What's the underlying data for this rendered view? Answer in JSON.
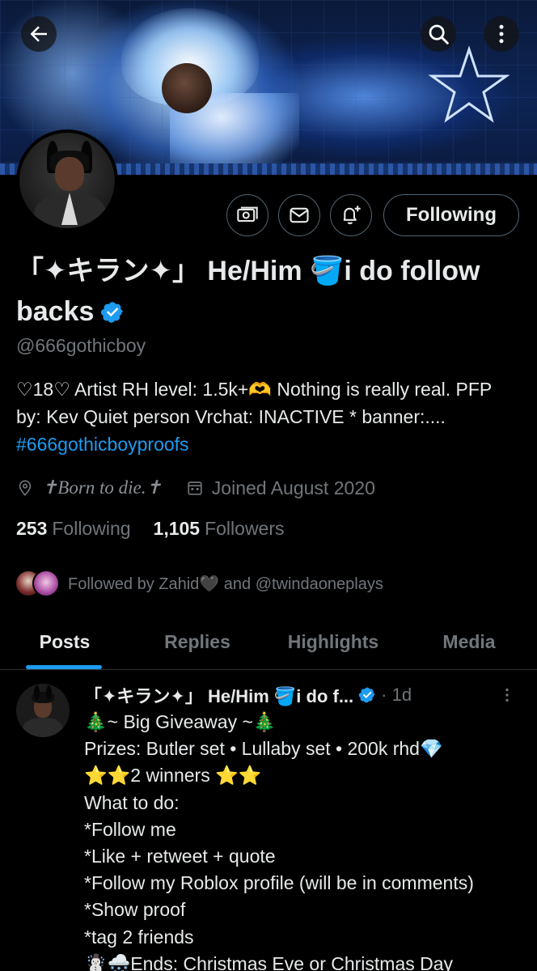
{
  "header": {
    "back_icon": "arrow-left-icon",
    "search_icon": "search-icon",
    "more_icon": "more-vertical-icon"
  },
  "profile": {
    "name": "「✦キラン✦」 He/Him 🪣i do follow backs",
    "verified": true,
    "handle": "@666gothicboy",
    "bio_text": "♡18♡ Artist RH level: 1.5k+🫶 Nothing is really real. PFP by: Kev Quiet person Vrchat: INACTIVE * banner:.... ",
    "bio_hashtag": "#666gothicboyproofs",
    "location": "✝Born to die.✝",
    "joined": "Joined August 2020",
    "following_count": "253",
    "following_label": "Following",
    "followers_count": "1,105",
    "followers_label": "Followers",
    "followed_by": "Followed by Zahid🖤 and @twindaoneplays"
  },
  "actions": {
    "subscribe_icon": "money-icon",
    "message_icon": "mail-icon",
    "notify_icon": "bell-plus-icon",
    "following_label": "Following"
  },
  "tabs": [
    {
      "label": "Posts",
      "active": true
    },
    {
      "label": "Replies",
      "active": false
    },
    {
      "label": "Highlights",
      "active": false
    },
    {
      "label": "Media",
      "active": false
    }
  ],
  "post": {
    "author": "「✦キラン✦」 He/Him 🪣i do f...",
    "time": "· 1d",
    "text": "🎄~ Big Giveaway ~🎄\nPrizes: Butler set • Lullaby set • 200k rhd💎\n⭐⭐2 winners ⭐⭐\nWhat to do:\n*Follow me\n*Like + retweet + quote\n*Follow my Roblox profile (will be in comments)\n*Show proof\n*tag 2 friends\n☃️🌨️Ends: Christmas Eve or Christmas Day"
  },
  "colors": {
    "background": "#000000",
    "text": "#e7e9ea",
    "muted": "#71767b",
    "accent": "#1d9bf0",
    "border": "#2f3336"
  }
}
